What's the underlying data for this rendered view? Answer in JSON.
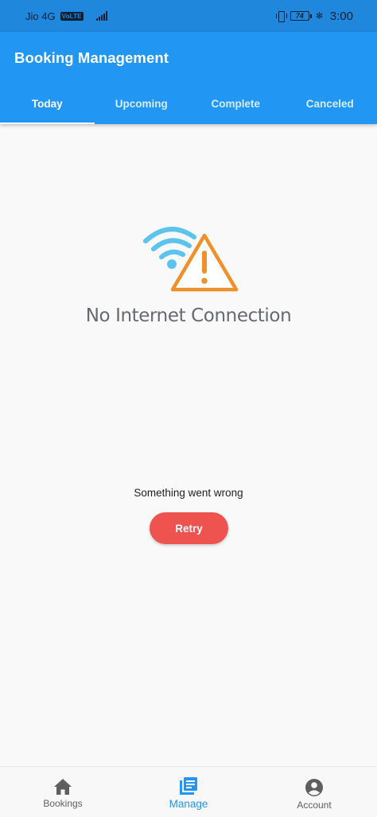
{
  "status_bar": {
    "carrier": "Jio 4G",
    "volte": "VoLTE",
    "battery": "74",
    "time": "3:00"
  },
  "app_bar": {
    "title": "Booking Management",
    "tabs": [
      {
        "label": "Today",
        "active": true
      },
      {
        "label": "Upcoming",
        "active": false
      },
      {
        "label": "Complete",
        "active": false
      },
      {
        "label": "Canceled",
        "active": false
      }
    ]
  },
  "content": {
    "illustration_text": "No Internet Connection",
    "error_message": "Something went wrong",
    "retry_label": "Retry"
  },
  "bottom_nav": {
    "items": [
      {
        "label": "Bookings",
        "icon": "home-icon",
        "active": false
      },
      {
        "label": "Manage",
        "icon": "list-icon",
        "active": true
      },
      {
        "label": "Account",
        "icon": "account-circle-icon",
        "active": false
      }
    ]
  },
  "colors": {
    "primary": "#2196f3",
    "status_bar": "#1f87dc",
    "retry_button": "#ef5350",
    "wifi_icon": "#5cc3ee",
    "warning_icon": "#f0902a"
  }
}
